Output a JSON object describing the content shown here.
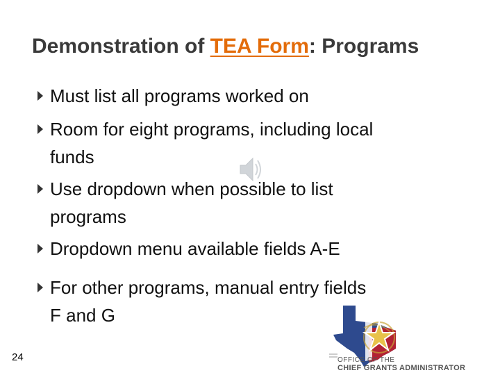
{
  "slide": {
    "title_prefix": "Demonstration of ",
    "title_link": "TEA Form",
    "title_suffix": ": Programs",
    "bullets": [
      {
        "line1": "Must list all programs worked on",
        "line2": ""
      },
      {
        "line1": "Room for eight programs, including local",
        "line2": "funds"
      },
      {
        "line1": "Use dropdown when possible to list",
        "line2": "programs"
      },
      {
        "line1": "Dropdown menu available fields A-E",
        "line2": ""
      },
      {
        "line1": "For other programs, manual entry fields",
        "line2": "F and G"
      }
    ],
    "page_number": "24",
    "logo_line1": "OFFICE OF THE",
    "logo_line2": "CHIEF GRANTS ADMINISTRATOR"
  },
  "colors": {
    "title": "#3a3a3a",
    "link": "#e36c0a",
    "text": "#111111",
    "texas_blue": "#2e4a8e",
    "texas_red": "#b22234",
    "star_gold": "#e8c24a"
  },
  "icons": {
    "bullet": "triangle-right-icon",
    "audio": "speaker-icon",
    "logo": "texas-star-logo"
  }
}
